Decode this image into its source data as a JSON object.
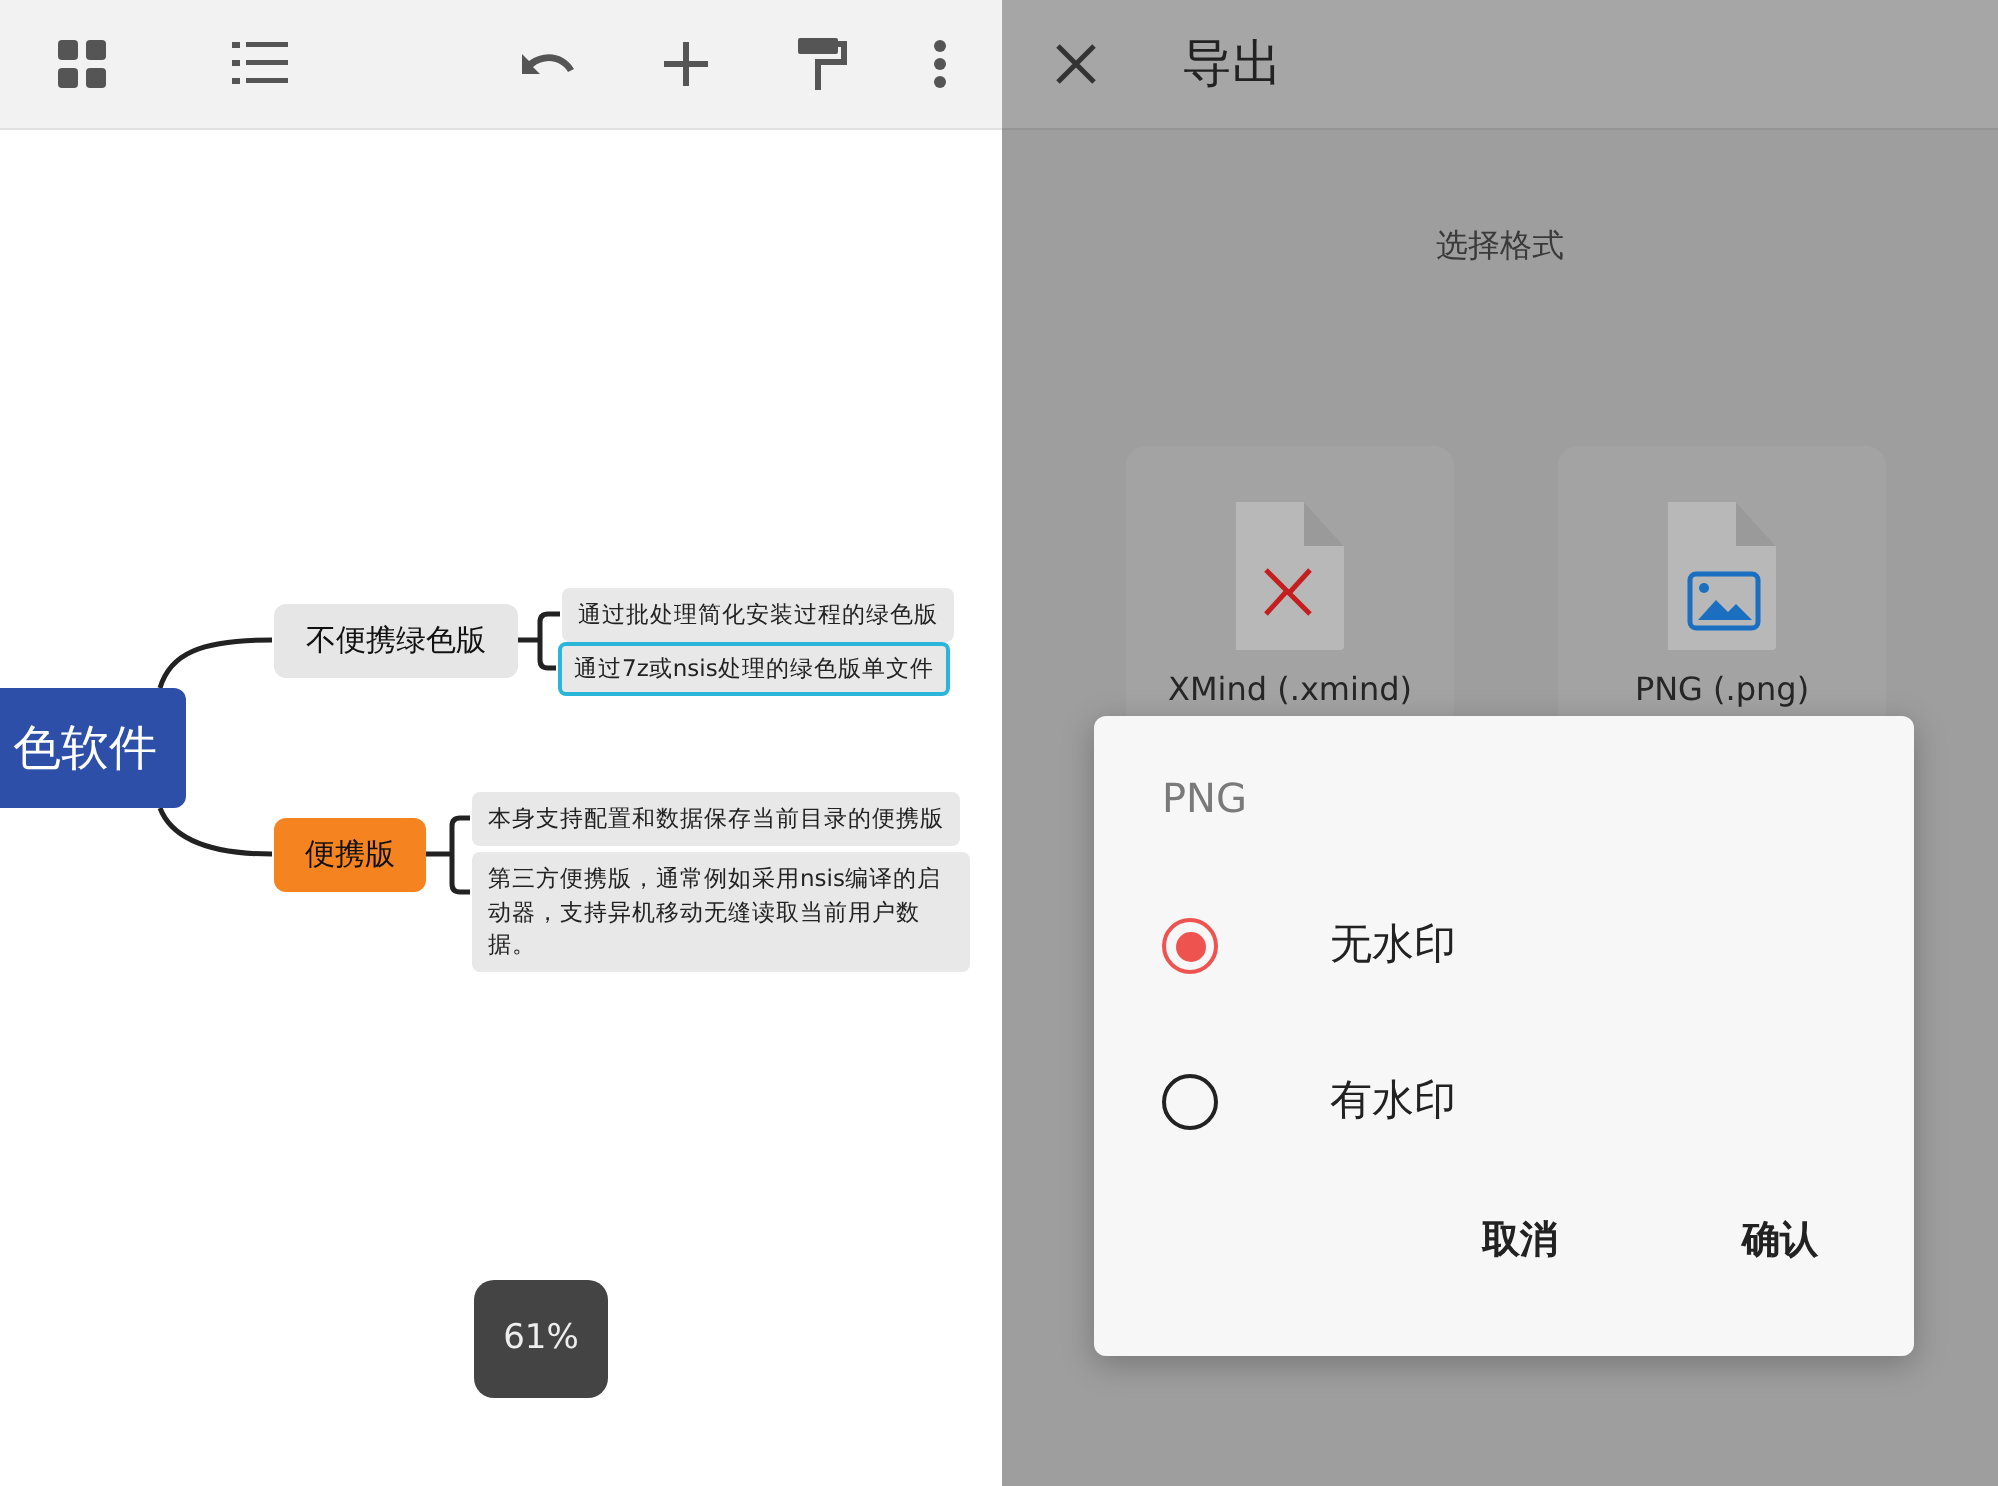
{
  "mindmap": {
    "root": {
      "label": "色软件",
      "color": "#2d4fa8",
      "branches": [
        {
          "label": "不便携绿色版",
          "color": "#e6e6e6",
          "children": [
            {
              "label": "通过批处理简化安装过程的绿色版",
              "selected": false
            },
            {
              "label": "通过7z或nsis处理的绿色版单文件",
              "selected": true
            }
          ]
        },
        {
          "label": "便携版",
          "color": "#f5831f",
          "children": [
            {
              "label": "本身支持配置和数据保存当前目录的便携版",
              "selected": false
            },
            {
              "label": "第三方便携版，通常例如采用nsis编译的启动器，支持异机移动无缝读取当前用户数据。",
              "selected": false
            }
          ]
        }
      ]
    }
  },
  "zoom": "61%",
  "export": {
    "title": "导出",
    "section": "选择格式",
    "formats": [
      {
        "label": "XMind (.xmind)",
        "kind": "xmind"
      },
      {
        "label": "PNG (.png)",
        "kind": "png"
      }
    ]
  },
  "dialog": {
    "title": "PNG",
    "options": [
      {
        "label": "无水印",
        "selected": true
      },
      {
        "label": "有水印",
        "selected": false
      }
    ],
    "buttons": [
      "取消",
      "确认"
    ]
  }
}
